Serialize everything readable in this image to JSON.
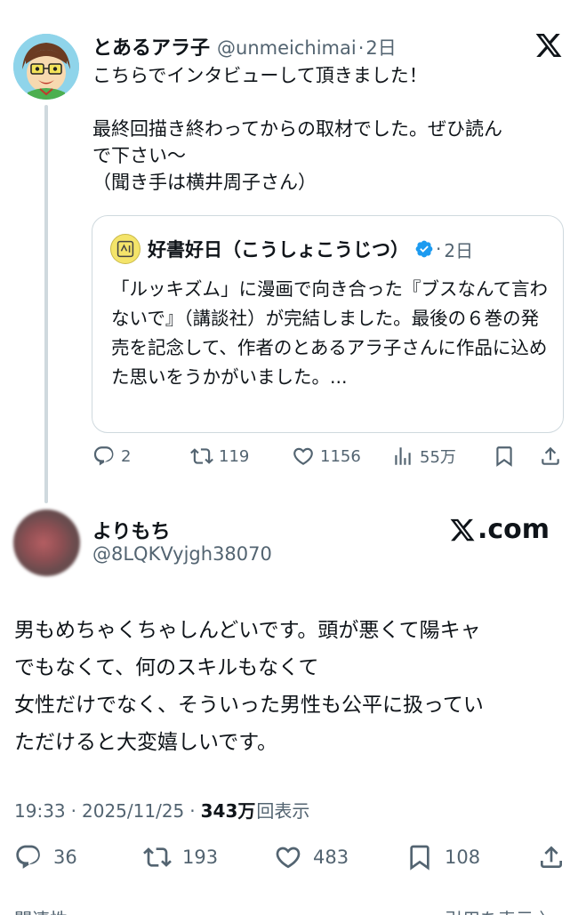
{
  "tweet1": {
    "author_name": "とあるアラ子",
    "handle": "@unmeichimai",
    "separator": "·",
    "time": "2日",
    "text_lines": [
      "こちらでインタビューして頂きました！",
      "",
      "最終回描き終わってからの取材でした。ぜひ読ん",
      "で下さい〜",
      "（聞き手は横井周子さん）"
    ],
    "quote": {
      "author_name": "好書好日（こうしょこうじつ）",
      "separator": "·",
      "time": "2日",
      "text": "「ルッキズム」に漫画で向き合った『ブスなんて言わないで』（講談社）が完結しました。最後の６巻の発売を記念して、作者のとあるアラ子さんに作品に込めた思いをうかがいました。..."
    },
    "actions": {
      "replies": "2",
      "reposts": "119",
      "likes": "1156",
      "views": "55万"
    }
  },
  "tweet2": {
    "author_name": "よりもち",
    "handle": "@8LQKVyjgh38070",
    "xcom_label": ".com",
    "text_lines": [
      "男もめちゃくちゃしんどいです。頭が悪くて陽キャ",
      "でもなくて、何のスキルもなくて",
      "女性だけでなく、そういった男性も公平に扱ってい",
      "ただけると大変嬉しいです。"
    ],
    "time": "19:33",
    "separator": "·",
    "date": "2025/11/25",
    "views_count": "343万",
    "views_label": "回表示",
    "actions": {
      "replies": "36",
      "reposts": "193",
      "likes": "483",
      "bookmarks": "108"
    }
  },
  "footer": {
    "left": "関連性",
    "right": "引用を表示 〉"
  },
  "colors": {
    "text": "#0f1419",
    "secondary": "#536471",
    "border": "#cfd9de",
    "verified": "#1d9bf0"
  }
}
